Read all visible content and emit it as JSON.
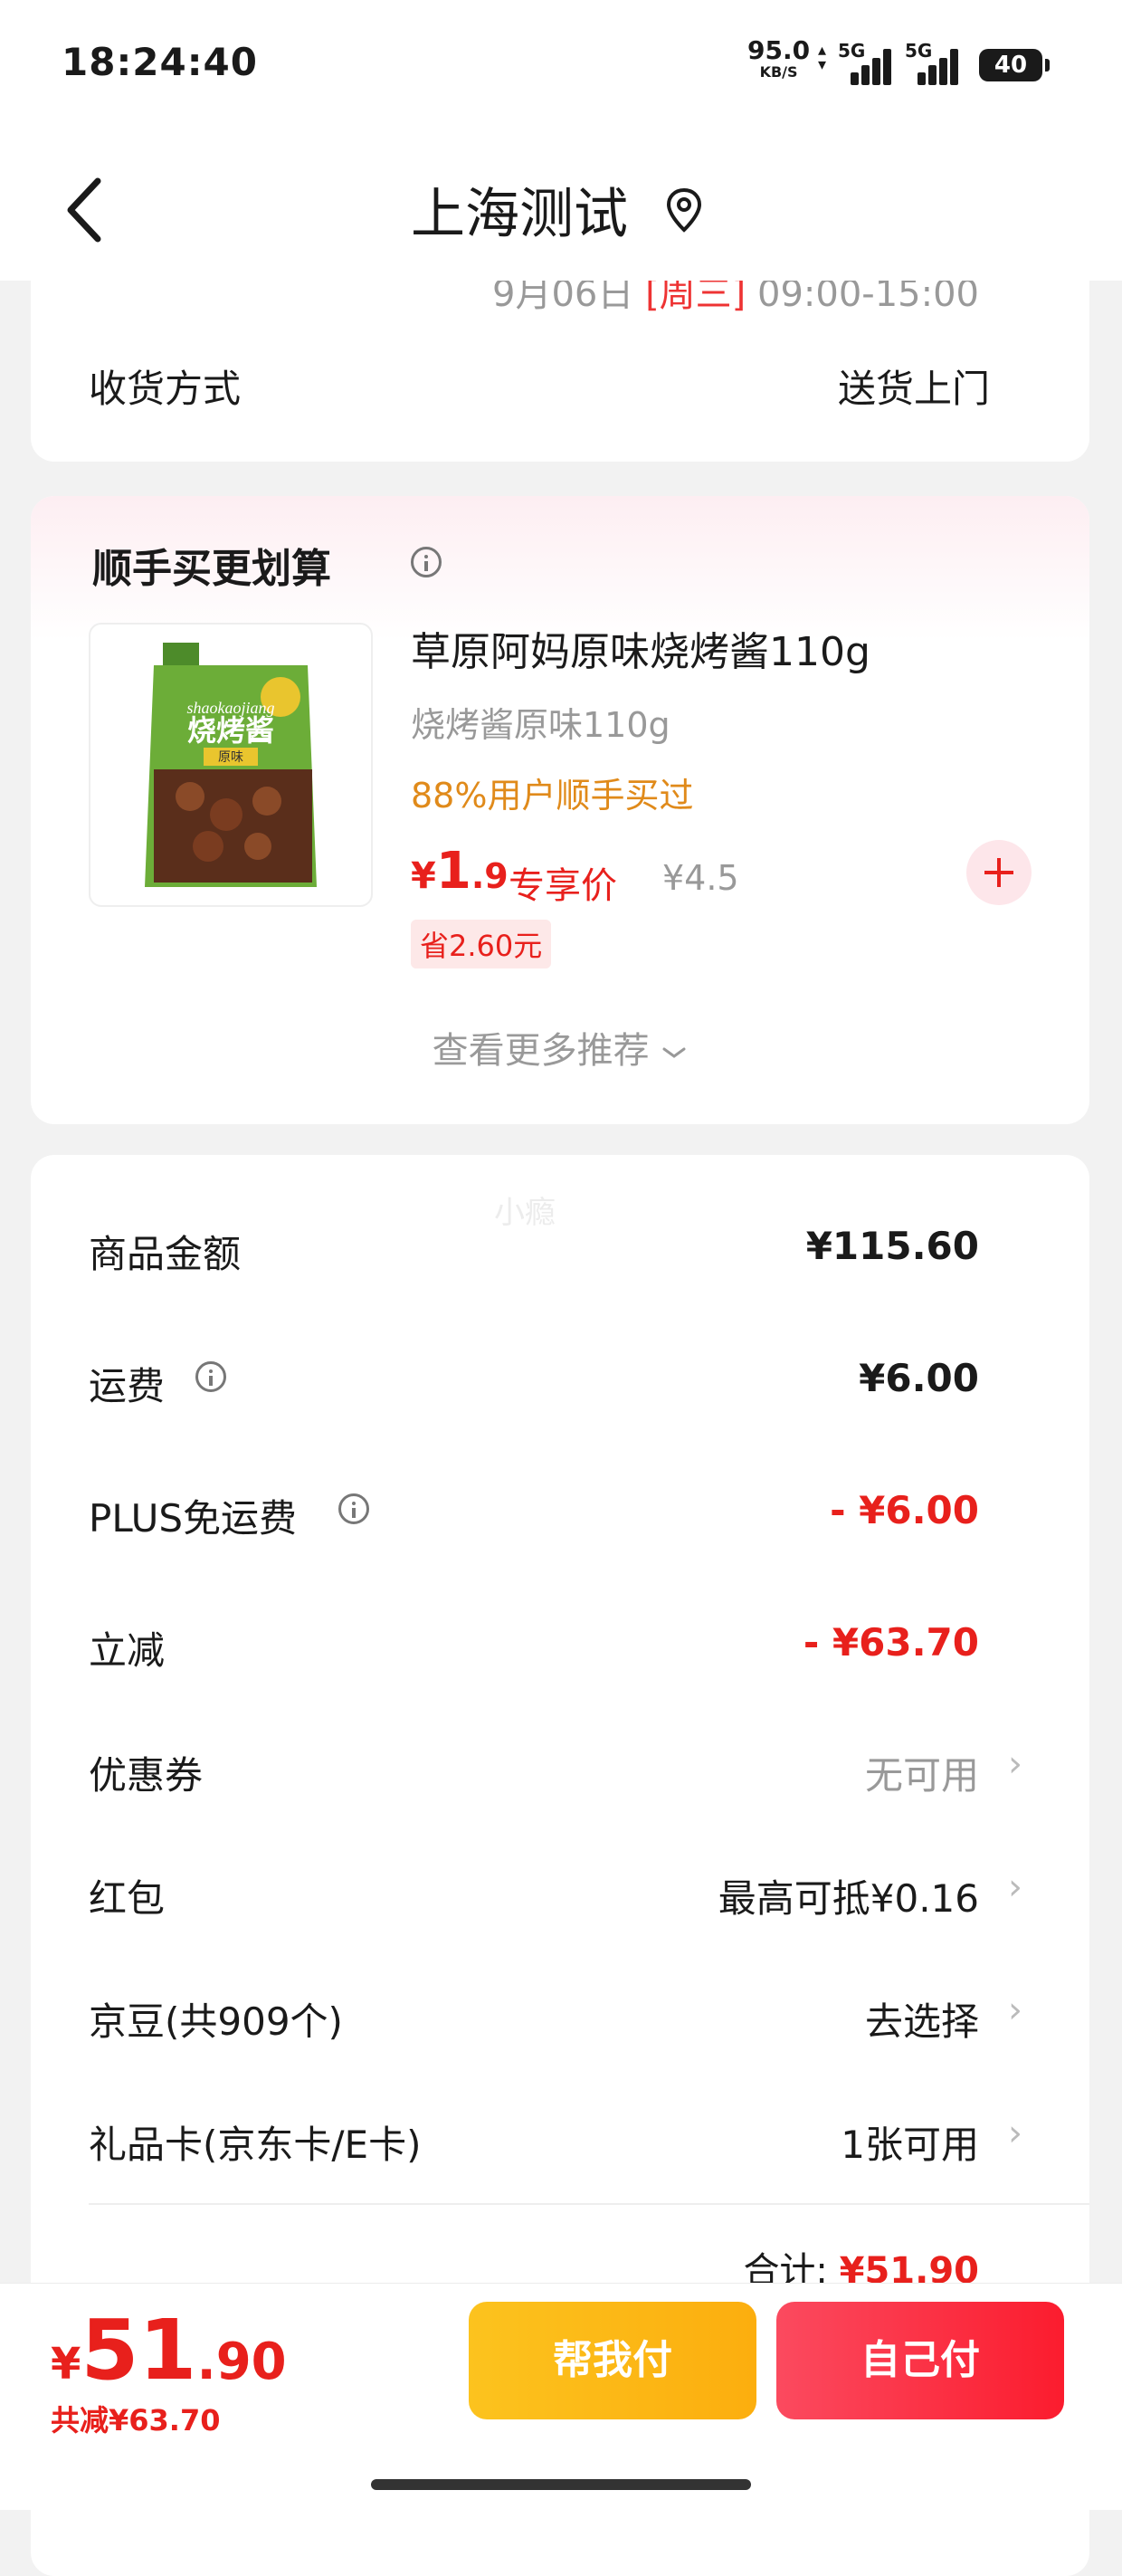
{
  "status_bar": {
    "time": "18:24:40",
    "net_speed": "95.0",
    "net_unit": "KB/S",
    "sim1": "5G",
    "sim2": "5G",
    "battery": "40"
  },
  "nav": {
    "title": "上海测试",
    "icons": [
      "back-icon",
      "location-icon"
    ]
  },
  "delivery": {
    "cut_text": "9月06日",
    "cut_tag": "[周三]",
    "cut_time": "09:00-15:00",
    "label": "收货方式",
    "value": "送货上门"
  },
  "recommend": {
    "title": "顺手买更划算",
    "product": {
      "name": "草原阿妈原味烧烤酱110g",
      "spec": "烧烤酱原味110g",
      "buyers": "88%用户顺手买过",
      "price_yen": "¥",
      "price_int": "1",
      "price_dec": ".9",
      "exclusive": "专享价",
      "original": "¥4.5",
      "save": "省2.60元",
      "image_text": "烧烤酱",
      "image_sub": "原味",
      "image_script": "shaokaojiang"
    },
    "more": "查看更多推荐"
  },
  "summary": {
    "watermark": "小瘾",
    "rows": [
      {
        "label": "商品金额",
        "value": "¥115.60"
      },
      {
        "label": "运费",
        "value": "¥6.00"
      },
      {
        "label": "PLUS免运费",
        "value": "- ¥6.00"
      },
      {
        "label": "立减",
        "value": "- ¥63.70"
      },
      {
        "label": "优惠券",
        "value": "无可用"
      },
      {
        "label": "红包",
        "value": "最高可抵¥0.16"
      },
      {
        "label": "京豆(共909个)",
        "value": "去选择"
      },
      {
        "label": "礼品卡(京东卡/E卡)",
        "value": "1张可用"
      }
    ],
    "total_label": "合计:",
    "total_value": "¥51.90"
  },
  "bottom_bar": {
    "yen": "¥",
    "price_int": "51",
    "price_dec": ".90",
    "saved": "共减¥63.70",
    "help_pay": "帮我付",
    "self_pay": "自己付"
  },
  "colors": {
    "accent_red": "#e8201c",
    "orange_text": "#e08a1a",
    "help_button": "#fcb916",
    "self_button": "#fb2a3c"
  }
}
